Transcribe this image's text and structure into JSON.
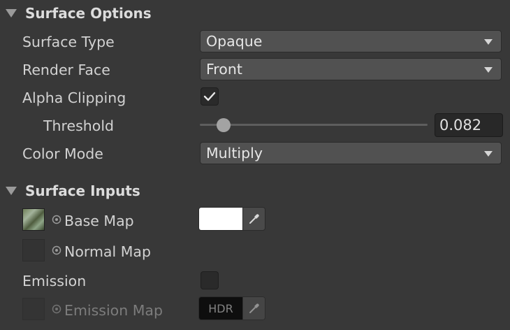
{
  "surface_options": {
    "header": "Surface Options",
    "surface_type": {
      "label": "Surface Type",
      "value": "Opaque"
    },
    "render_face": {
      "label": "Render Face",
      "value": "Front"
    },
    "alpha_clipping": {
      "label": "Alpha Clipping",
      "checked": true
    },
    "threshold": {
      "label": "Threshold",
      "value": "0.082",
      "slider_fraction": 0.082
    },
    "color_mode": {
      "label": "Color Mode",
      "value": "Multiply"
    }
  },
  "surface_inputs": {
    "header": "Surface Inputs",
    "base_map": {
      "label": "Base Map",
      "color": "#ffffff"
    },
    "normal_map": {
      "label": "Normal Map"
    },
    "emission": {
      "label": "Emission",
      "checked": false
    },
    "emission_map": {
      "label": "Emission Map",
      "hdr_label": "HDR",
      "color": "#000000"
    }
  },
  "icons": {
    "foldout": "triangle-down-icon",
    "dropdown": "chevron-down-icon",
    "checkmark": "checkmark-icon",
    "eyedropper": "eyedropper-icon",
    "picker": "object-picker-icon"
  }
}
